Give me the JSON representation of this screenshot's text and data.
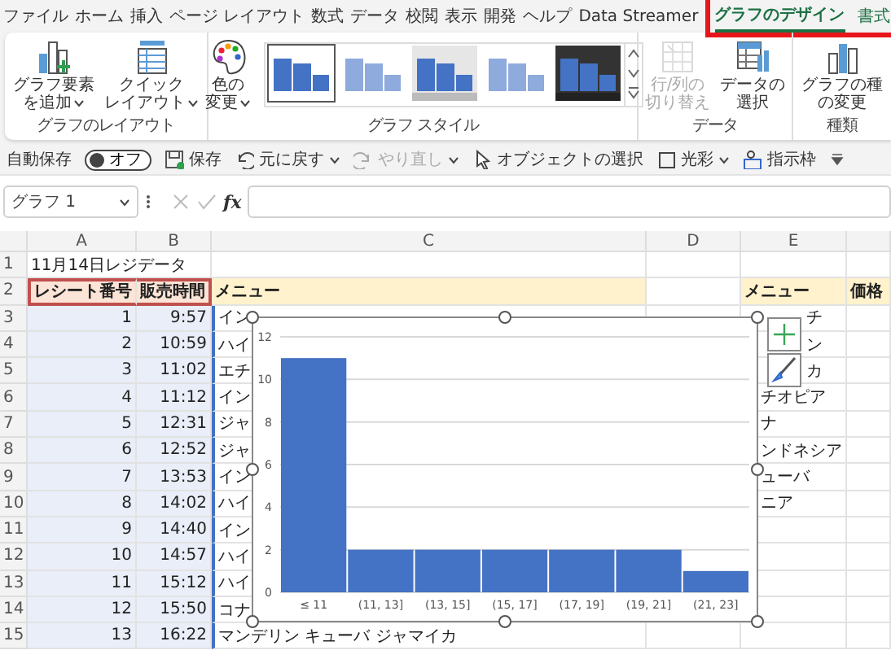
{
  "tabs": [
    {
      "label": "ファイル",
      "selected": false,
      "highlighted": false
    },
    {
      "label": "ホーム",
      "selected": false,
      "highlighted": false
    },
    {
      "label": "挿入",
      "selected": false,
      "highlighted": false
    },
    {
      "label": "ページ レイアウト",
      "selected": false,
      "highlighted": false
    },
    {
      "label": "数式",
      "selected": false,
      "highlighted": false
    },
    {
      "label": "データ",
      "selected": false,
      "highlighted": false
    },
    {
      "label": "校閲",
      "selected": false,
      "highlighted": false
    },
    {
      "label": "表示",
      "selected": false,
      "highlighted": false
    },
    {
      "label": "開発",
      "selected": false,
      "highlighted": false
    },
    {
      "label": "ヘルプ",
      "selected": false,
      "highlighted": false
    },
    {
      "label": "Data Streamer",
      "selected": false,
      "highlighted": false
    },
    {
      "label": "グラフのデザイン",
      "selected": true,
      "highlighted": true
    },
    {
      "label": "書式",
      "selected": false,
      "highlighted": true
    }
  ],
  "ribbon": {
    "groups": [
      {
        "label": "グラフのレイアウト",
        "kind": "buttons",
        "buttons": [
          {
            "lines": [
              "グラフ要素",
              "を追加"
            ],
            "dropdown": true,
            "disabled": false
          },
          {
            "lines": [
              "クイック",
              "レイアウト"
            ],
            "dropdown": true,
            "disabled": false
          }
        ]
      },
      {
        "label": "グラフ スタイル",
        "kind": "gallery",
        "buttons": [
          {
            "lines": [
              "色の",
              "変更"
            ],
            "dropdown": true,
            "disabled": false
          }
        ],
        "styles": [
          {
            "kind": "white",
            "selected": true
          },
          {
            "kind": "pale",
            "selected": false
          },
          {
            "kind": "gray",
            "selected": false
          },
          {
            "kind": "pale",
            "selected": false
          },
          {
            "kind": "dark",
            "selected": false
          }
        ]
      },
      {
        "label": "データ",
        "kind": "buttons",
        "buttons": [
          {
            "lines": [
              "行/列の",
              "切り替え"
            ],
            "dropdown": false,
            "disabled": true
          },
          {
            "lines": [
              "データの",
              "選択"
            ],
            "dropdown": false,
            "disabled": false
          }
        ]
      },
      {
        "label": "種類",
        "kind": "buttons",
        "buttons": [
          {
            "lines": [
              "グラフの種",
              "の変更"
            ],
            "dropdown": false,
            "disabled": false
          }
        ]
      }
    ]
  },
  "quick_access": [
    {
      "kind": "label",
      "text": "自動保存"
    },
    {
      "kind": "toggle",
      "text": "オフ",
      "on": false
    },
    {
      "kind": "button",
      "text": "保存",
      "dropdown": false,
      "disabled": false
    },
    {
      "kind": "button",
      "text": "元に戻す",
      "dropdown": true,
      "disabled": false
    },
    {
      "kind": "button",
      "text": "やり直し",
      "dropdown": true,
      "disabled": true
    },
    {
      "kind": "button",
      "text": "オブジェクトの選択",
      "dropdown": false,
      "disabled": false
    },
    {
      "kind": "button",
      "text": "光彩",
      "dropdown": true,
      "disabled": false
    },
    {
      "kind": "button",
      "text": "指示枠",
      "dropdown": false,
      "disabled": false
    },
    {
      "kind": "more"
    }
  ],
  "formula_bar": {
    "name_box": "グラフ 1",
    "function_label": "fx"
  },
  "sheet": {
    "columns": [
      "A",
      "B",
      "C",
      "D",
      "E"
    ],
    "rows": [
      {
        "number": "1",
        "kind": "title",
        "a": "11月14日レジデータ"
      },
      {
        "number": "2",
        "kind": "header",
        "a": "レシート番号",
        "b": "販売時間",
        "c": "メニュー",
        "e": "メニュー",
        "f": "価格"
      },
      {
        "number": "3",
        "kind": "data",
        "a": "1",
        "b": "9:57",
        "c": "イン",
        "e": "チ"
      },
      {
        "number": "4",
        "kind": "data",
        "a": "2",
        "b": "10:59",
        "c": "ハイ",
        "e": "ン"
      },
      {
        "number": "5",
        "kind": "data",
        "a": "3",
        "b": "11:02",
        "c": "エチ",
        "e": "カ"
      },
      {
        "number": "6",
        "kind": "data",
        "a": "4",
        "b": "11:12",
        "c": "イン",
        "e": "チオピア"
      },
      {
        "number": "7",
        "kind": "data",
        "a": "5",
        "b": "12:31",
        "c": "ジャ",
        "e": "ナ"
      },
      {
        "number": "8",
        "kind": "data",
        "a": "6",
        "b": "12:52",
        "c": "ジャ",
        "e": "ンドネシア"
      },
      {
        "number": "9",
        "kind": "data",
        "a": "7",
        "b": "13:53",
        "c": "イン",
        "e": "ューバ"
      },
      {
        "number": "10",
        "kind": "data",
        "a": "8",
        "b": "14:02",
        "c": "ハイ",
        "e": "ニア"
      },
      {
        "number": "11",
        "kind": "data",
        "a": "9",
        "b": "14:40",
        "c": "イン"
      },
      {
        "number": "12",
        "kind": "data",
        "a": "10",
        "b": "14:57",
        "c": "ハイ"
      },
      {
        "number": "13",
        "kind": "data",
        "a": "11",
        "b": "15:12",
        "c": "ハイ"
      },
      {
        "number": "14",
        "kind": "data",
        "a": "12",
        "b": "15:50",
        "c": "コナ"
      },
      {
        "number": "15",
        "kind": "data",
        "a": "13",
        "b": "16:22",
        "c": "マンデリン キューバ ジャマイカ"
      }
    ]
  },
  "chart": {
    "chart_data": {
      "type": "bar",
      "categories": [
        "≤ 11",
        "(11, 13]",
        "(13, 15]",
        "(15, 17]",
        "(17, 19]",
        "(19, 21]",
        "(21, 23]"
      ],
      "series": [
        {
          "color": "#4472c4",
          "values": [
            11,
            2,
            2,
            2,
            2,
            2,
            1
          ]
        }
      ],
      "grid": true,
      "ylim": [
        0,
        12
      ],
      "yticks": [
        0,
        2,
        4,
        6,
        8,
        10,
        12
      ]
    }
  }
}
